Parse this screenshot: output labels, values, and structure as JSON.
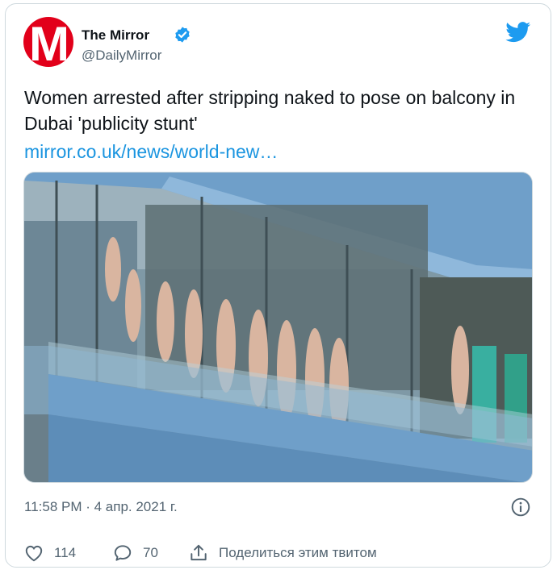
{
  "tweet": {
    "author_name": "The Mirror",
    "author_handle": "@DailyMirror",
    "avatar_letter": "M",
    "text": "Women arrested after stripping naked to pose on balcony in Dubai 'publicity stunt'",
    "link_text": "mirror.co.uk/news/world-new…",
    "timestamp": "11:58 PM · 4 апр. 2021 г.",
    "media_description": "Photo of balcony",
    "actions": {
      "likes": "114",
      "replies": "70",
      "share_label": "Поделиться этим твитом"
    }
  },
  "colors": {
    "brand_red": "#e2001a",
    "link_blue": "#1b95e0",
    "twitter_blue": "#1d9bf0",
    "muted": "#536471"
  },
  "icons": [
    "mirror-avatar",
    "verified-badge-icon",
    "twitter-bird-icon",
    "info-icon",
    "heart-icon",
    "reply-bubble-icon",
    "share-icon"
  ]
}
